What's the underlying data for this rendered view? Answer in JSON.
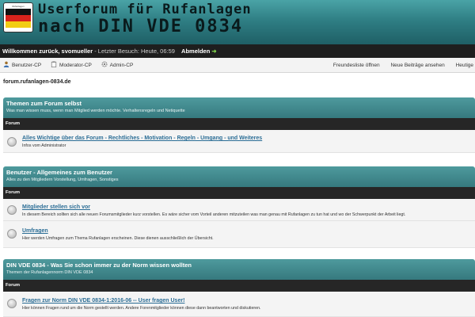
{
  "banner": {
    "logo_text": "Rufanlagen",
    "flag_colors": [
      "#111111",
      "#d8231c",
      "#f2cd13"
    ],
    "title": "Userforum für Rufanlagen",
    "subtitle": "nach DIN VDE 0834"
  },
  "welcome": {
    "greeting": "Willkommen zurück, svomueller",
    "last_visit": " - Letzter Besuch: Heute, 06:59",
    "logout": "Abmelden",
    "logout_arrow": "➜"
  },
  "nav": {
    "left": [
      {
        "label": "Benutzer-CP",
        "icon": "user-icon"
      },
      {
        "label": "Moderator-CP",
        "icon": "clipboard-icon"
      },
      {
        "label": "Admin-CP",
        "icon": "gear-icon"
      }
    ],
    "right": [
      "Freundesliste öffnen",
      "Neue Beiträge ansehen",
      "Heutige"
    ]
  },
  "site_name": "forum.rufanlagen-0834.de",
  "colors": {
    "banner_teal": "#2f7f84",
    "category_teal": "#3f888c",
    "link_blue": "#2c6e96"
  },
  "categories": [
    {
      "title": "Themen zum Forum selbst",
      "desc": "Was man wissen muss, wenn man Mitglied werden möchte. Verhaltensregeln und Netiquette",
      "col_header": "Forum",
      "forums": [
        {
          "title": "Alles Wichtige über das Forum - Rechtliches - Motivation - Regeln - Umgang - und Weiteres",
          "desc": "Infos vom Administrator"
        }
      ]
    },
    {
      "title": "Benutzer - Allgemeines zum Benutzer",
      "desc": "Alles zu den Mitgliedern Vorstellung, Umfragen, Sonstiges",
      "col_header": "Forum",
      "forums": [
        {
          "title": "Mitglieder stellen sich vor",
          "desc": "In diesem Bereich sollten sich alle neuen Forumsmitglieder kurz vorstellen. Es wäre sicher vom Vorteil anderen mitzuteilen was man genau mit Rufanlagen zu tun hat und wo der Schwerpunkt der Arbeit liegt."
        },
        {
          "title": "Umfragen",
          "desc": "Hier werden Umfragen zum Thema Rufanlagen erscheinen. Diese dienen ausschließlich der Übersicht."
        }
      ]
    },
    {
      "title": "DIN VDE 0834 - Was Sie schon immer zu der Norm wissen wollten",
      "desc": "Themen der Rufanlagennorm DIN VDE 0834",
      "col_header": "Forum",
      "forums": [
        {
          "title": "Fragen zur Norm DIN VDE 0834-1:2016-06 -- User fragen User!",
          "desc": "Hier können Fragen rund um die Norm gestellt werden. Andere Forenmitglieder können diese dann beantworten und diskutieren."
        }
      ]
    }
  ]
}
